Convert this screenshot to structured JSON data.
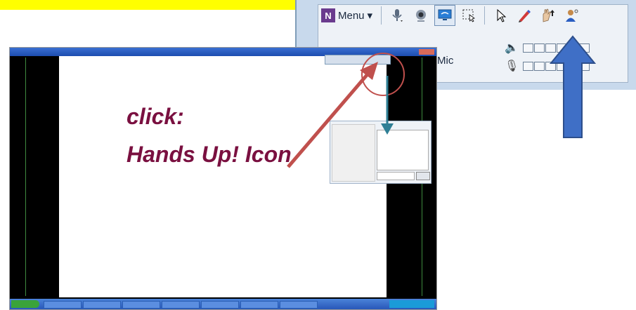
{
  "toolbar": {
    "menu_label": "Menu",
    "menu_arrow": "▾",
    "icons": [
      "microphone-icon",
      "webcam-icon",
      "screen-share-icon",
      "select-region-icon",
      "pointer-icon",
      "pen-icon",
      "hand-raise-icon",
      "user-icon"
    ],
    "mic_label": "Mic"
  },
  "annotation": {
    "line1": "click:",
    "line2": "Hands Up! Icon"
  },
  "colors": {
    "banner": "#ffff00",
    "annotation_text": "#7a1040",
    "blue_arrow": "#3f6fc6",
    "red_arrow": "#c0504d",
    "teal_arrow": "#2f7f95"
  }
}
